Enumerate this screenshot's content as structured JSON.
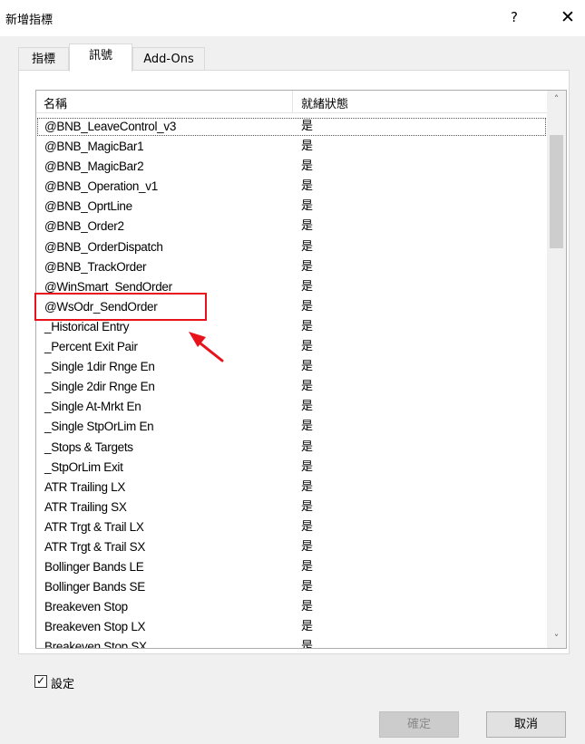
{
  "window": {
    "title": "新增指標",
    "help_label": "?",
    "close_label": "✕"
  },
  "tabs": [
    {
      "label": "指標",
      "active": false
    },
    {
      "label": "訊號",
      "active": true
    },
    {
      "label": "Add-Ons",
      "active": false
    }
  ],
  "list": {
    "columns": {
      "name": "名稱",
      "status": "就緒狀態"
    },
    "selected_row": "@BNB_LeaveControl_v3",
    "highlighted_row": "@WsOdr_SendOrder",
    "rows": [
      {
        "name": "@BNB_LeaveControl_v3",
        "status": "是"
      },
      {
        "name": "@BNB_MagicBar1",
        "status": "是"
      },
      {
        "name": "@BNB_MagicBar2",
        "status": "是"
      },
      {
        "name": "@BNB_Operation_v1",
        "status": "是"
      },
      {
        "name": "@BNB_OprtLine",
        "status": "是"
      },
      {
        "name": "@BNB_Order2",
        "status": "是"
      },
      {
        "name": "@BNB_OrderDispatch",
        "status": "是"
      },
      {
        "name": "@BNB_TrackOrder",
        "status": "是"
      },
      {
        "name": "@WinSmart_SendOrder",
        "status": "是"
      },
      {
        "name": "@WsOdr_SendOrder",
        "status": "是"
      },
      {
        "name": "_Historical Entry",
        "status": "是"
      },
      {
        "name": "_Percent Exit Pair",
        "status": "是"
      },
      {
        "name": "_Single 1dir Rnge En",
        "status": "是"
      },
      {
        "name": "_Single 2dir Rnge En",
        "status": "是"
      },
      {
        "name": "_Single At-Mrkt En",
        "status": "是"
      },
      {
        "name": "_Single StpOrLim En",
        "status": "是"
      },
      {
        "name": "_Stops & Targets",
        "status": "是"
      },
      {
        "name": "_StpOrLim Exit",
        "status": "是"
      },
      {
        "name": "ATR Trailing LX",
        "status": "是"
      },
      {
        "name": "ATR Trailing SX",
        "status": "是"
      },
      {
        "name": "ATR Trgt & Trail LX",
        "status": "是"
      },
      {
        "name": "ATR Trgt & Trail SX",
        "status": "是"
      },
      {
        "name": "Bollinger Bands LE",
        "status": "是"
      },
      {
        "name": "Bollinger Bands SE",
        "status": "是"
      },
      {
        "name": "Breakeven Stop",
        "status": "是"
      },
      {
        "name": "Breakeven Stop LX",
        "status": "是"
      },
      {
        "name": "Breakeven Stop SX",
        "status": "是"
      }
    ]
  },
  "scrollbar": {
    "up_icon": "chevron-up-icon",
    "down_icon": "chevron-down-icon",
    "up_glyph": "˄",
    "down_glyph": "˅"
  },
  "checkbox": {
    "label": "設定",
    "checked": true,
    "mark": "✓"
  },
  "buttons": {
    "ok_label": "確定",
    "ok_enabled": false,
    "cancel_label": "取消"
  },
  "annotation": {
    "highlight_color": "#e8131a"
  }
}
